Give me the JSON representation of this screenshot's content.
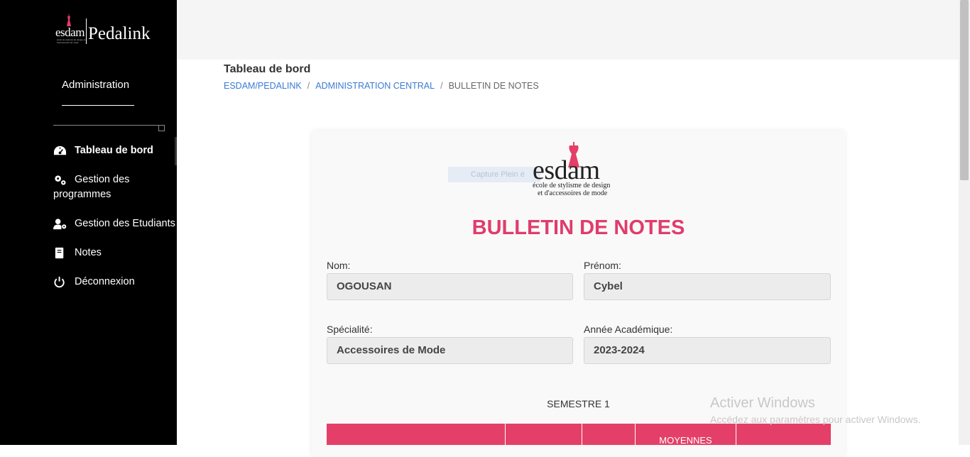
{
  "sidebar": {
    "logo": {
      "mini_word": "esdam",
      "mini_tagline": "école de stylisme de design et d'accessoires de mode",
      "brand": "Pedalink"
    },
    "section_title": "Administration",
    "items": [
      {
        "label": "Tableau de bord",
        "icon": "dashboard-icon",
        "active": true
      },
      {
        "label": "Gestion des programmes",
        "icon": "gears-icon"
      },
      {
        "label": "Gestion des Etudiants",
        "icon": "user-gear-icon"
      },
      {
        "label": "Notes",
        "icon": "book-icon"
      },
      {
        "label": "Déconnexion",
        "icon": "power-icon"
      }
    ]
  },
  "header": {
    "page_title": "Tableau de bord",
    "breadcrumb": [
      "ESDAM/PEDALINK",
      "ADMINISTRATION CENTRAL",
      "BULLETIN DE NOTES"
    ]
  },
  "card": {
    "capture_overlay": "Capture Plein é",
    "logo": {
      "word": "esdam",
      "tagline_1": "école de stylisme de design",
      "tagline_2": "et d'accessoires de mode"
    },
    "title": "BULLETIN DE NOTES",
    "fields": {
      "nom": {
        "label": "Nom:",
        "value": "OGOUSAN"
      },
      "prenom": {
        "label": "Prénom:",
        "value": "Cybel"
      },
      "specialite": {
        "label": "Spécialité:",
        "value": "Accessoires de Mode"
      },
      "annee": {
        "label": "Année Académique:",
        "value": "2023-2024"
      }
    },
    "semestre": "SEMESTRE 1",
    "table_headers": [
      "",
      "",
      "",
      "MOYENNES",
      ""
    ]
  },
  "watermark": {
    "line1": "Activer Windows",
    "line2": "Accédez aux paramètres pour activer Windows."
  },
  "colors": {
    "accent": "#e43f68",
    "title": "#e03c6c",
    "link": "#3a7bd5",
    "sidebar": "#000000"
  }
}
